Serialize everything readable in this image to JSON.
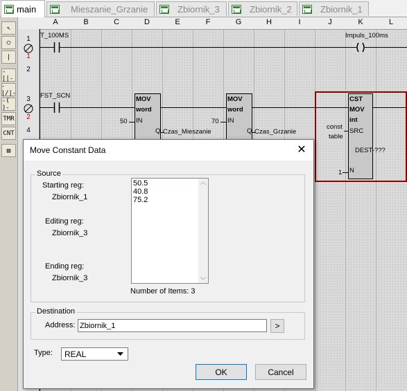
{
  "tabs": [
    {
      "label": "main",
      "active": true
    },
    {
      "label": "Mieszanie_Grzanie",
      "active": false
    },
    {
      "label": "Zbiornik_3",
      "active": false
    },
    {
      "label": "Zbiornik_2",
      "active": false
    },
    {
      "label": "Zbiornik_1",
      "active": false
    }
  ],
  "toolbar": {
    "items": [
      {
        "name": "pointer-tool",
        "glyph": "↖"
      },
      {
        "name": "lasso-tool",
        "glyph": "◯"
      },
      {
        "name": "vertical-wire-tool",
        "glyph": "|"
      },
      {
        "name": "no-contact-tool",
        "glyph": "-||-"
      },
      {
        "name": "nc-contact-tool",
        "glyph": "-|/|-"
      },
      {
        "name": "coil-tool",
        "glyph": "-( )-"
      },
      {
        "name": "timer-tool",
        "glyph": "TMR"
      },
      {
        "name": "counter-tool",
        "glyph": "CNT"
      },
      {
        "name": "function-block-tool",
        "glyph": "▤"
      }
    ]
  },
  "ladder": {
    "columns": [
      "A",
      "B",
      "C",
      "D",
      "E",
      "F",
      "G",
      "H",
      "I",
      "J",
      "K",
      "L"
    ],
    "rungs": [
      {
        "num": "1",
        "sub": "1"
      },
      {
        "num": "2",
        "sub": ""
      },
      {
        "num": "3",
        "sub": "2"
      },
      {
        "num": "4",
        "sub": ""
      }
    ],
    "rung1": {
      "contact": "T_100MS",
      "coil": "Impuls_100ms"
    },
    "rung3": {
      "contact": "FST_SCN",
      "mov1": {
        "t1": "MOV",
        "t2": "word",
        "in_val": "50",
        "in_pin": "IN",
        "q_pin": "Q",
        "out": "Czas_Mieszanie"
      },
      "mov2": {
        "t1": "MOV",
        "t2": "word",
        "in_val": "70",
        "in_pin": "IN",
        "q_pin": "Q",
        "out": "Czas_Grzanie"
      },
      "cst": {
        "t1": "CST",
        "t2": "MOV",
        "t3": "int",
        "src_label_1": "const",
        "src_label_2": "table",
        "src_pin": "SRC",
        "dest": "DEST-???",
        "n_val": "1",
        "n_pin": "N"
      }
    }
  },
  "dialog": {
    "title": "Move Constant Data",
    "source_label": "Source",
    "starting_reg_label": "Starting reg:",
    "starting_reg_value": "Zbiornik_1",
    "editing_reg_label": "Editing reg:",
    "editing_reg_value": "Zbiornik_3",
    "ending_reg_label": "Ending reg:",
    "ending_reg_value": "Zbiornik_3",
    "list_items": [
      "50.5",
      "40.8",
      "75.2"
    ],
    "count_label": "Number of Items: 3",
    "destination_label": "Destination",
    "address_label": "Address:",
    "address_value": "Zbiornik_1",
    "browse_label": ">",
    "type_label": "Type:",
    "type_value": "REAL",
    "ok_label": "OK",
    "cancel_label": "Cancel"
  }
}
